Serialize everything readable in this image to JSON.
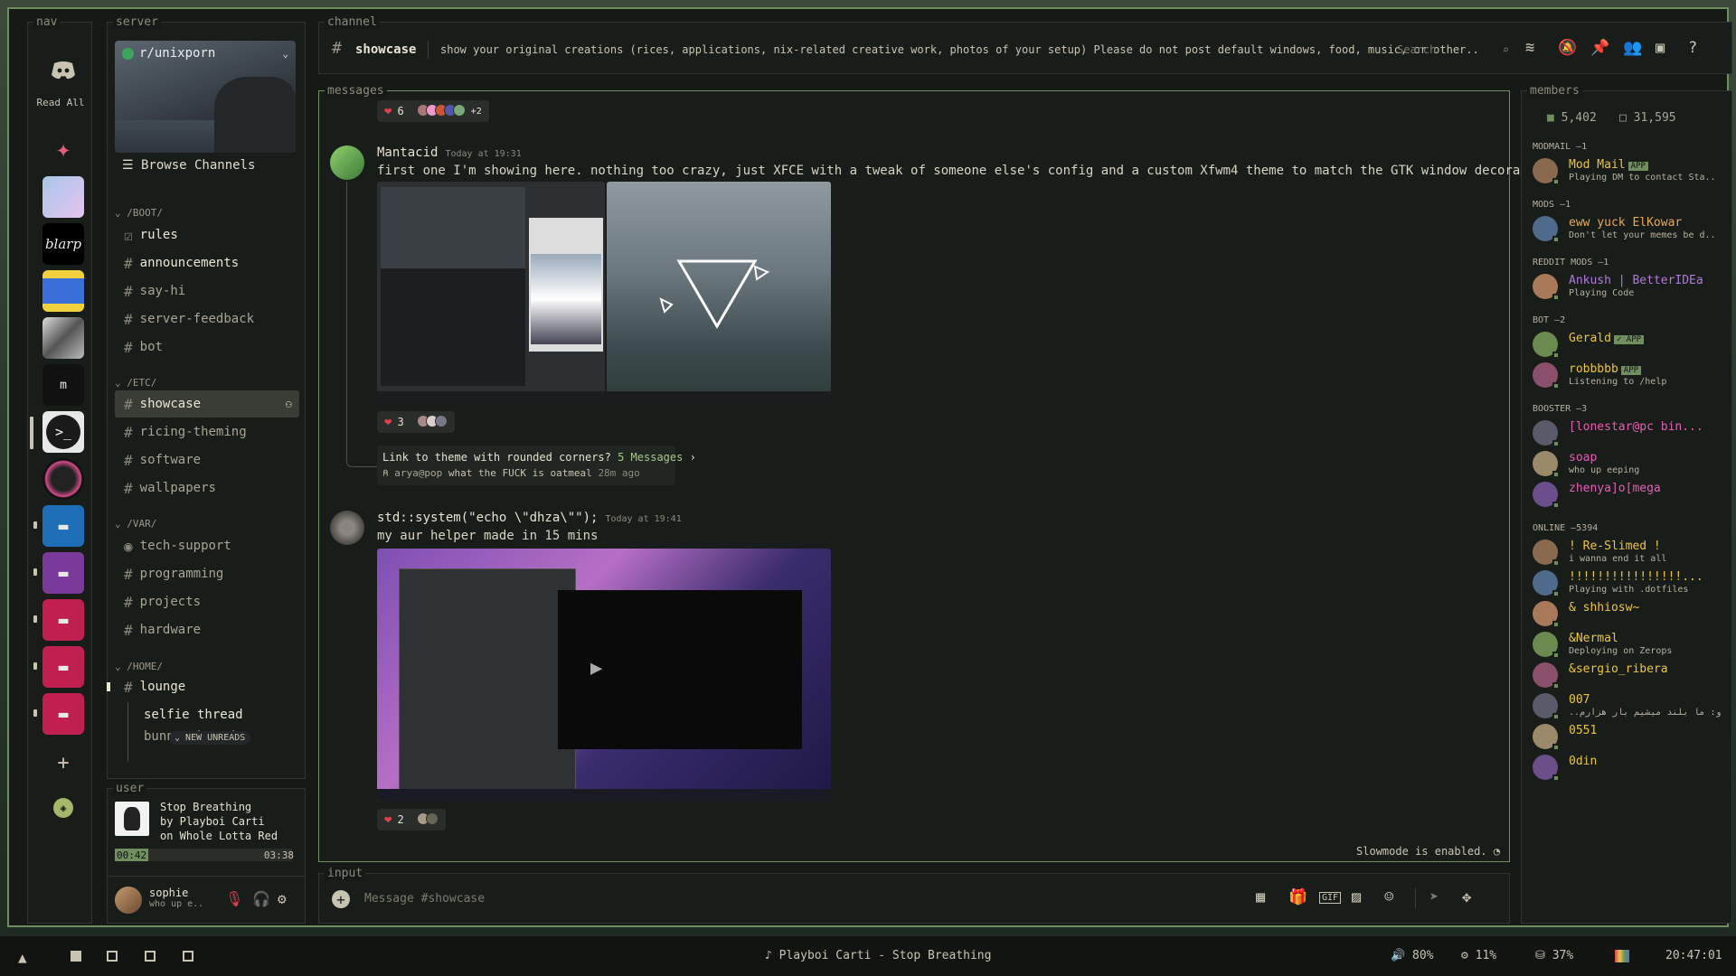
{
  "labels": {
    "nav": "nav",
    "server": "server",
    "channel": "channel",
    "messages": "messages",
    "members": "members",
    "user": "user",
    "input": "input"
  },
  "nav": {
    "read_all": "Read All"
  },
  "server": {
    "name": "r/unixporn",
    "browse": "Browse Channels",
    "categories": [
      {
        "name": "/BOOT/",
        "channels": [
          "rules",
          "announcements",
          "say-hi",
          "server-feedback",
          "bot"
        ]
      },
      {
        "name": "/ETC/",
        "channels": [
          "showcase",
          "ricing-theming",
          "software",
          "wallpapers"
        ]
      },
      {
        "name": "/VAR/",
        "channels": [
          "tech-support",
          "programming",
          "projects",
          "hardware"
        ]
      },
      {
        "name": "/HOME/",
        "channels": [
          "lounge",
          "selfie thread",
          "bunny thread"
        ]
      }
    ],
    "new_unreads": "NEW UNREADS"
  },
  "user": {
    "track": "Stop Breathing",
    "artist_line": "by Playboi Carti",
    "album_line": "on Whole Lotta Red",
    "elapsed": "00:42",
    "duration": "03:38",
    "progress_fraction": 0.19,
    "username": "sophie",
    "status": "who up e.."
  },
  "channel": {
    "name": "showcase",
    "topic": "show your original creations (rices, applications, nix-related creative work, photos of your setup) Please do not post default windows, food, music, or other..",
    "search_placeholder": "Search"
  },
  "messages": {
    "top_reaction": {
      "count": "6",
      "extra": "+2"
    },
    "msg1": {
      "author": "Mantacid",
      "timestamp": "Today at 19:31",
      "text": "first one I'm showing here. nothing too crazy, just XFCE with a tweak of someone else's config and a custom Xfwm4 theme to match the GTK window decorations.",
      "reaction_count": "3",
      "thread_title": "Link to theme with rounded corners?",
      "thread_count": "5 Messages",
      "thread_author": "arya@pop",
      "thread_preview": "what the FUCK is oatmeal",
      "thread_age": "28m ago"
    },
    "msg2": {
      "author": "std::system(\"echo \\\"dhza\\\"\");",
      "timestamp": "Today at 19:41",
      "text": "my aur helper made in 15 mins",
      "reaction_count": "2"
    },
    "slowmode": "Slowmode is enabled."
  },
  "members": {
    "online_count": "5,402",
    "total_count": "31,595",
    "sections": [
      {
        "title": "MODMAIL —1",
        "members": [
          {
            "name": "Mod Mail",
            "tag": "APP",
            "sub": "Playing DM to contact Sta..",
            "color": "#e8c547"
          }
        ]
      },
      {
        "title": "MODS —1",
        "members": [
          {
            "name": "eww yuck ElKowar",
            "sub": "Don't let your memes be d..",
            "color": "#e8a95b"
          }
        ]
      },
      {
        "title": "REDDIT MODS —1",
        "members": [
          {
            "name": "Ankush | BetterIDEa",
            "sub": "Playing Code",
            "color": "#b07ad9"
          }
        ]
      },
      {
        "title": "BOT —2",
        "members": [
          {
            "name": "Gerald",
            "tag": "✓ APP",
            "sub": "",
            "color": "#e8c547"
          },
          {
            "name": "robbbbb",
            "tag": "APP",
            "sub": "Listening to /help",
            "color": "#e8c547"
          }
        ]
      },
      {
        "title": "BOOSTER —3",
        "members": [
          {
            "name": "[lonestar@pc bin...",
            "sub": "",
            "color": "#e05fb0"
          },
          {
            "name": "soap",
            "sub": "who up eeping",
            "color": "#e05fb0"
          },
          {
            "name": "zhenya]o[mega",
            "sub": "",
            "color": "#e05fb0"
          }
        ]
      },
      {
        "title": "ONLINE —5394",
        "members": [
          {
            "name": "! Re-Slimed !",
            "sub": "i wanna end it all",
            "color": "#e8c547"
          },
          {
            "name": "!!!!!!!!!!!!!!!!...",
            "sub": "Playing with .dotfiles",
            "color": "#e8c547"
          },
          {
            "name": "& shhiosw~",
            "sub": "",
            "color": "#e8c547"
          },
          {
            "name": "&Nermal",
            "sub": "Deploying on Zerops",
            "color": "#e8c547"
          },
          {
            "name": "&sergio_ribera",
            "sub": "",
            "color": "#e8c547"
          },
          {
            "name": "007",
            "sub": "..ارو: ما بلند میشیم بار هزارم",
            "color": "#e8c547"
          },
          {
            "name": "0551",
            "sub": "",
            "color": "#e8c547"
          },
          {
            "name": "0din",
            "sub": "",
            "color": "#e8c547"
          }
        ]
      }
    ]
  },
  "input": {
    "placeholder": "Message #showcase"
  },
  "taskbar": {
    "now_playing": "Playboi Carti - Stop Breathing",
    "volume": "80%",
    "cpu": "11%",
    "disk": "37%",
    "clock": "20:47:01"
  }
}
